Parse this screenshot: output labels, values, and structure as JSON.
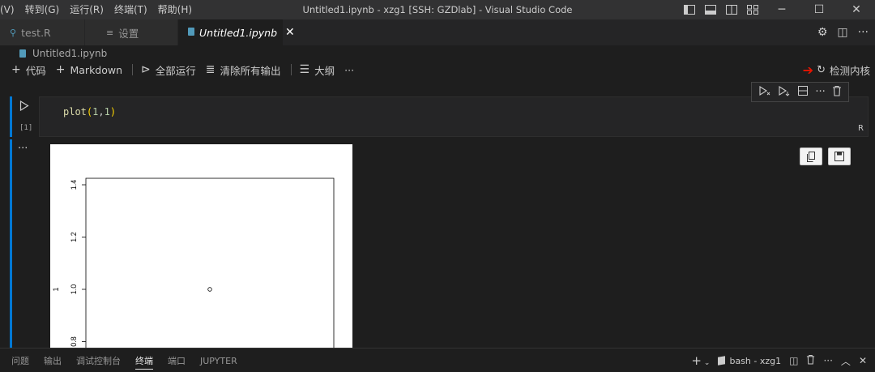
{
  "menu": [
    "(V)",
    "转到(G)",
    "运行(R)",
    "终端(T)",
    "帮助(H)"
  ],
  "window_title": "Untitled1.ipynb - xzg1 [SSH: GZDlab] - Visual Studio Code",
  "window_controls": {
    "minimize": "─",
    "maximize": "☐",
    "close": "✕"
  },
  "tabs": [
    {
      "label": "test.R",
      "icon": "r-file-icon"
    },
    {
      "label": "设置",
      "icon": "settings-file-icon"
    },
    {
      "label": "Untitled1.ipynb",
      "icon": "notebook-file-icon",
      "active": true
    }
  ],
  "breadcrumb": "Untitled1.ipynb",
  "toolbar": {
    "add_code": "代码",
    "add_markdown": "Markdown",
    "run_all": "全部运行",
    "clear_outputs": "清除所有输出",
    "outline": "大纲",
    "more": "···"
  },
  "kernel_label": "检测内核",
  "cell": {
    "exec_count": "[1]",
    "code": {
      "fn": "plot",
      "open": "(",
      "arg1": "1",
      "comma": ",",
      "arg2": "1",
      "close": ")"
    },
    "language": "R"
  },
  "plot": {
    "ylabel": "1",
    "y_ticks": [
      "0.8",
      "1.0",
      "1.2",
      "1.4"
    ]
  },
  "chart_data": {
    "type": "scatter",
    "x": [
      1
    ],
    "y": [
      1
    ],
    "ylabel": "1",
    "ylim": [
      0.6,
      1.4
    ],
    "y_ticks": [
      0.8,
      1.0,
      1.2,
      1.4
    ],
    "grid": false
  },
  "panel": {
    "tabs": [
      "问题",
      "输出",
      "调试控制台",
      "终端",
      "端口",
      "JUPYTER"
    ],
    "active_tab": "终端",
    "terminal_label": "bash - xzg1"
  },
  "colors": {
    "accent": "#0078d4",
    "arrow": "#e51400",
    "notebook_icon": "#519aba"
  }
}
